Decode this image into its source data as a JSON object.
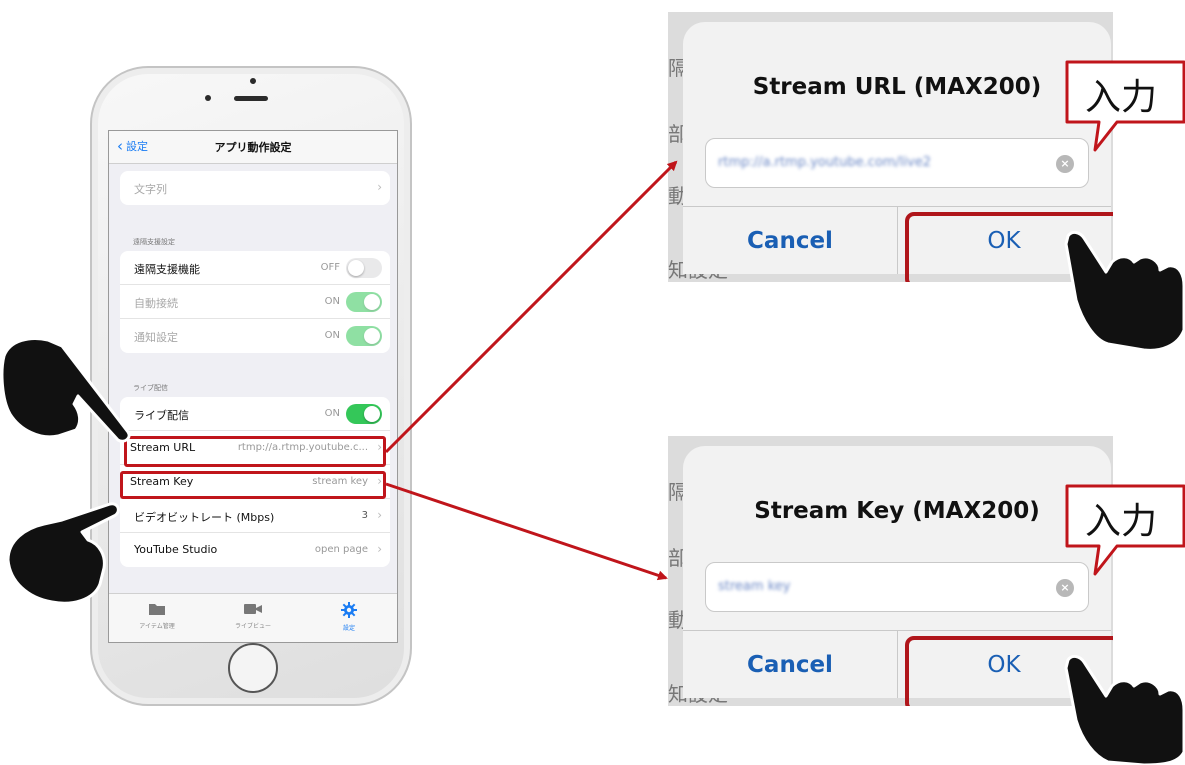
{
  "colors": {
    "accent_red": "#c0151b",
    "ios_blue": "#1a7cf3",
    "switch_green": "#34c759"
  },
  "nav": {
    "back_label": "設定",
    "title": "アプリ動作設定"
  },
  "top_row": {
    "label": "文字列"
  },
  "remote_section": {
    "header": "遠隔支援設定",
    "rows": [
      {
        "label": "遠隔支援機能",
        "state": "OFF"
      },
      {
        "label": "自動接続",
        "state": "ON"
      },
      {
        "label": "通知設定",
        "state": "ON"
      }
    ]
  },
  "live_section": {
    "header": "ライブ配信",
    "toggle": {
      "label": "ライブ配信",
      "state": "ON"
    },
    "stream_url": {
      "label": "Stream URL",
      "value": "rtmp://a.rtmp.youtube.c..."
    },
    "stream_key": {
      "label": "Stream Key",
      "value": "stream key"
    },
    "bitrate": {
      "label": "ビデオビットレート (Mbps)",
      "value": "3"
    },
    "studio": {
      "label": "YouTube Studio",
      "value": "open page"
    }
  },
  "tabbar": [
    {
      "label": "アイテム管理",
      "icon": "folder-icon"
    },
    {
      "label": "ライブビュー",
      "icon": "video-camera-icon"
    },
    {
      "label": "設定",
      "icon": "gear-icon"
    }
  ],
  "dialog_url": {
    "title": "Stream URL (MAX200)",
    "field_value": "rtmp://a.rtmp.youtube.com/live2",
    "cancel_label": "Cancel",
    "ok_label": "OK"
  },
  "dialog_key": {
    "title": "Stream Key (MAX200)",
    "field_value": "stream key",
    "cancel_label": "Cancel",
    "ok_label": "OK"
  },
  "callout_label": "入力",
  "background_fragments": {
    "a": "知設定",
    "b": "部",
    "c": "隔",
    "d": "動"
  }
}
